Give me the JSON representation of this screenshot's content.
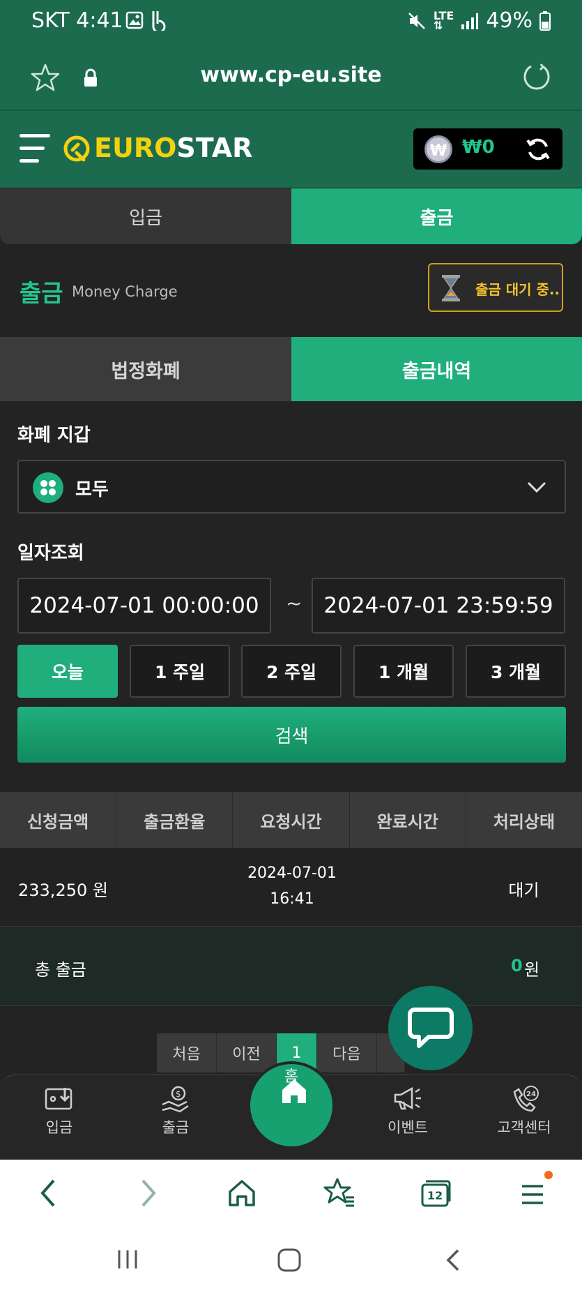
{
  "status_bar": {
    "time": "SKT 4:41",
    "battery": "49%"
  },
  "browser": {
    "url": "www.cp-eu.site"
  },
  "header": {
    "logo_part1": "EURO",
    "logo_part2": "STAR",
    "balance": "₩0",
    "currency_symbol": "₩"
  },
  "top_tabs": {
    "deposit": "입금",
    "withdraw": "출금"
  },
  "page": {
    "title": "출금",
    "subtitle": "Money Charge",
    "pending_label": "출금 대기 중.."
  },
  "sub_tabs": {
    "fiat": "법정화폐",
    "history": "출금내역"
  },
  "wallet_section": {
    "label": "화폐 지갑",
    "selected": "모두"
  },
  "date_section": {
    "label": "일자조회",
    "from": "2024-07-01 00:00:00",
    "separator": "~",
    "to": "2024-07-01 23:59:59",
    "quick": [
      "오늘",
      "1 주일",
      "2 주일",
      "1 개월",
      "3 개월"
    ],
    "search": "검색"
  },
  "table": {
    "headers": [
      "신청금액",
      "출금환율",
      "요청시간",
      "완료시간",
      "처리상태"
    ],
    "row": {
      "amount": "233,250 원",
      "request_date": "2024-07-01",
      "request_time": "16:41",
      "status": "대기"
    },
    "total_label": "총 출금",
    "total_value": "0",
    "total_unit": "원"
  },
  "pagination": {
    "first": "처음",
    "prev": "이전",
    "current": "1",
    "next": "다음"
  },
  "bottom_nav": {
    "deposit": "입금",
    "withdraw": "출금",
    "home": "홈",
    "event": "이벤트",
    "support": "고객센터"
  },
  "browser_toolbar": {
    "tabs_count": "12"
  },
  "colors": {
    "primary": "#1fae7c",
    "header": "#1c6b4f",
    "warning": "#f2c230"
  }
}
